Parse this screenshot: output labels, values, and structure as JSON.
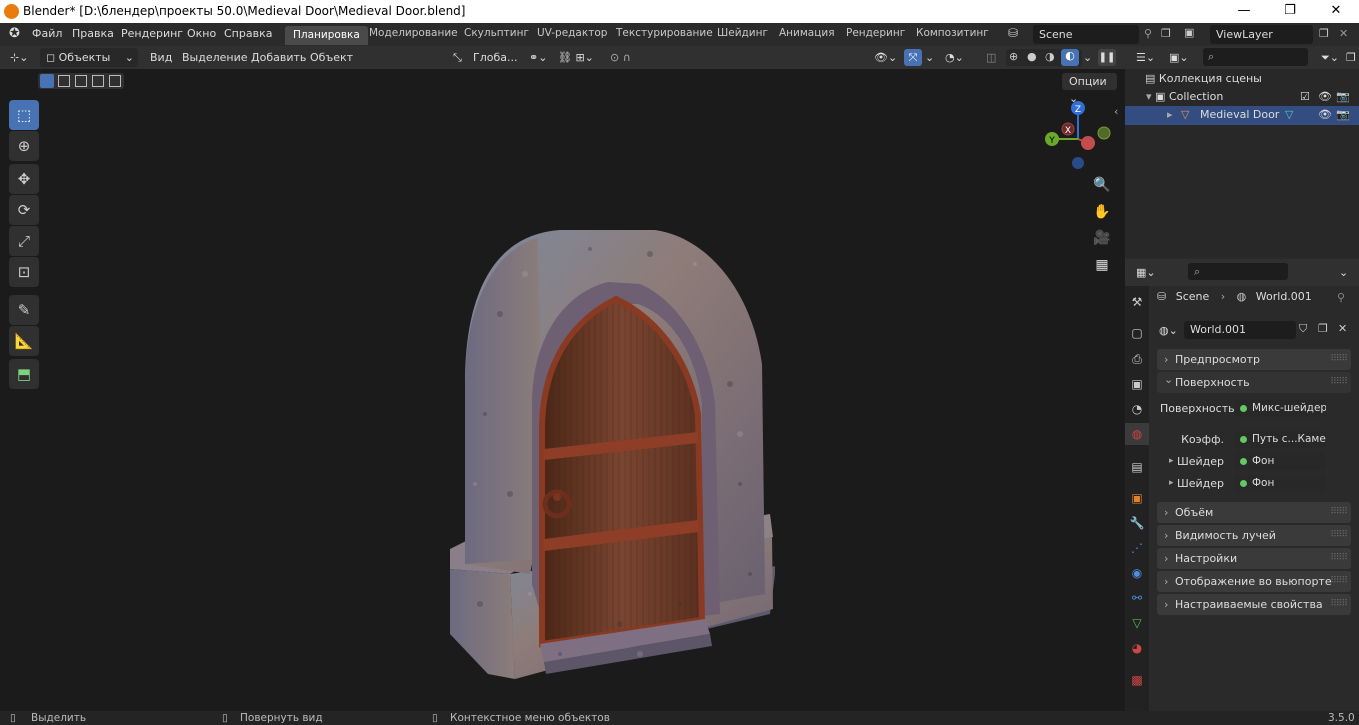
{
  "window": {
    "title": "Blender* [D:\\блендер\\проекты 50.0\\Medieval Door\\Medieval Door.blend]",
    "minimize": "—",
    "maximize": "❐",
    "close": "✕"
  },
  "menu": [
    "Файл",
    "Правка",
    "Рендеринг",
    "Окно",
    "Справка"
  ],
  "workspaces": [
    "Планировка",
    "Моделирование",
    "Скульптинг",
    "UV-редактор",
    "Текстурирование",
    "Шейдинг",
    "Анимация",
    "Рендеринг",
    "Композитинг"
  ],
  "scene": {
    "name": "Scene",
    "view_layer": "ViewLayer"
  },
  "header": {
    "mode": "Объекты",
    "menus": [
      "Вид",
      "Выделение",
      "Добавить",
      "Объект"
    ],
    "orientation": "Глоба...",
    "options": "Опции"
  },
  "gizmo": {
    "x": "X",
    "y": "Y",
    "z": "Z"
  },
  "outliner": {
    "search_placeholder": "",
    "rows": [
      {
        "label": "Коллекция сцены"
      },
      {
        "label": "Collection"
      },
      {
        "label": "Medieval Door"
      }
    ]
  },
  "properties": {
    "breadcrumb_scene": "Scene",
    "breadcrumb_world": "World.001",
    "world_name": "World.001",
    "panels": {
      "preview": "Предпросмотр",
      "surface": "Поверхность",
      "volume": "Объём",
      "ray_visibility": "Видимость лучей",
      "settings": "Настройки",
      "viewport_display": "Отображение во вьюпорте",
      "custom_props": "Настраиваемые свойства"
    },
    "surface": {
      "label": "Поверхность",
      "value": "Микс-шейдер",
      "fac_label": "Коэфф.",
      "fac_value": "Путь с...Камеры",
      "shader1_label": "Шейдер",
      "shader1_value": "Фон",
      "shader2_label": "Шейдер",
      "shader2_value": "Фон"
    }
  },
  "status": {
    "select": "Выделить",
    "rotate": "Повернуть вид",
    "context": "Контекстное меню объектов",
    "version": "3.5.0"
  },
  "colors": {
    "accent": "#4772b3",
    "door_wood": "#6a3a22",
    "stone": "#8a7a78"
  }
}
